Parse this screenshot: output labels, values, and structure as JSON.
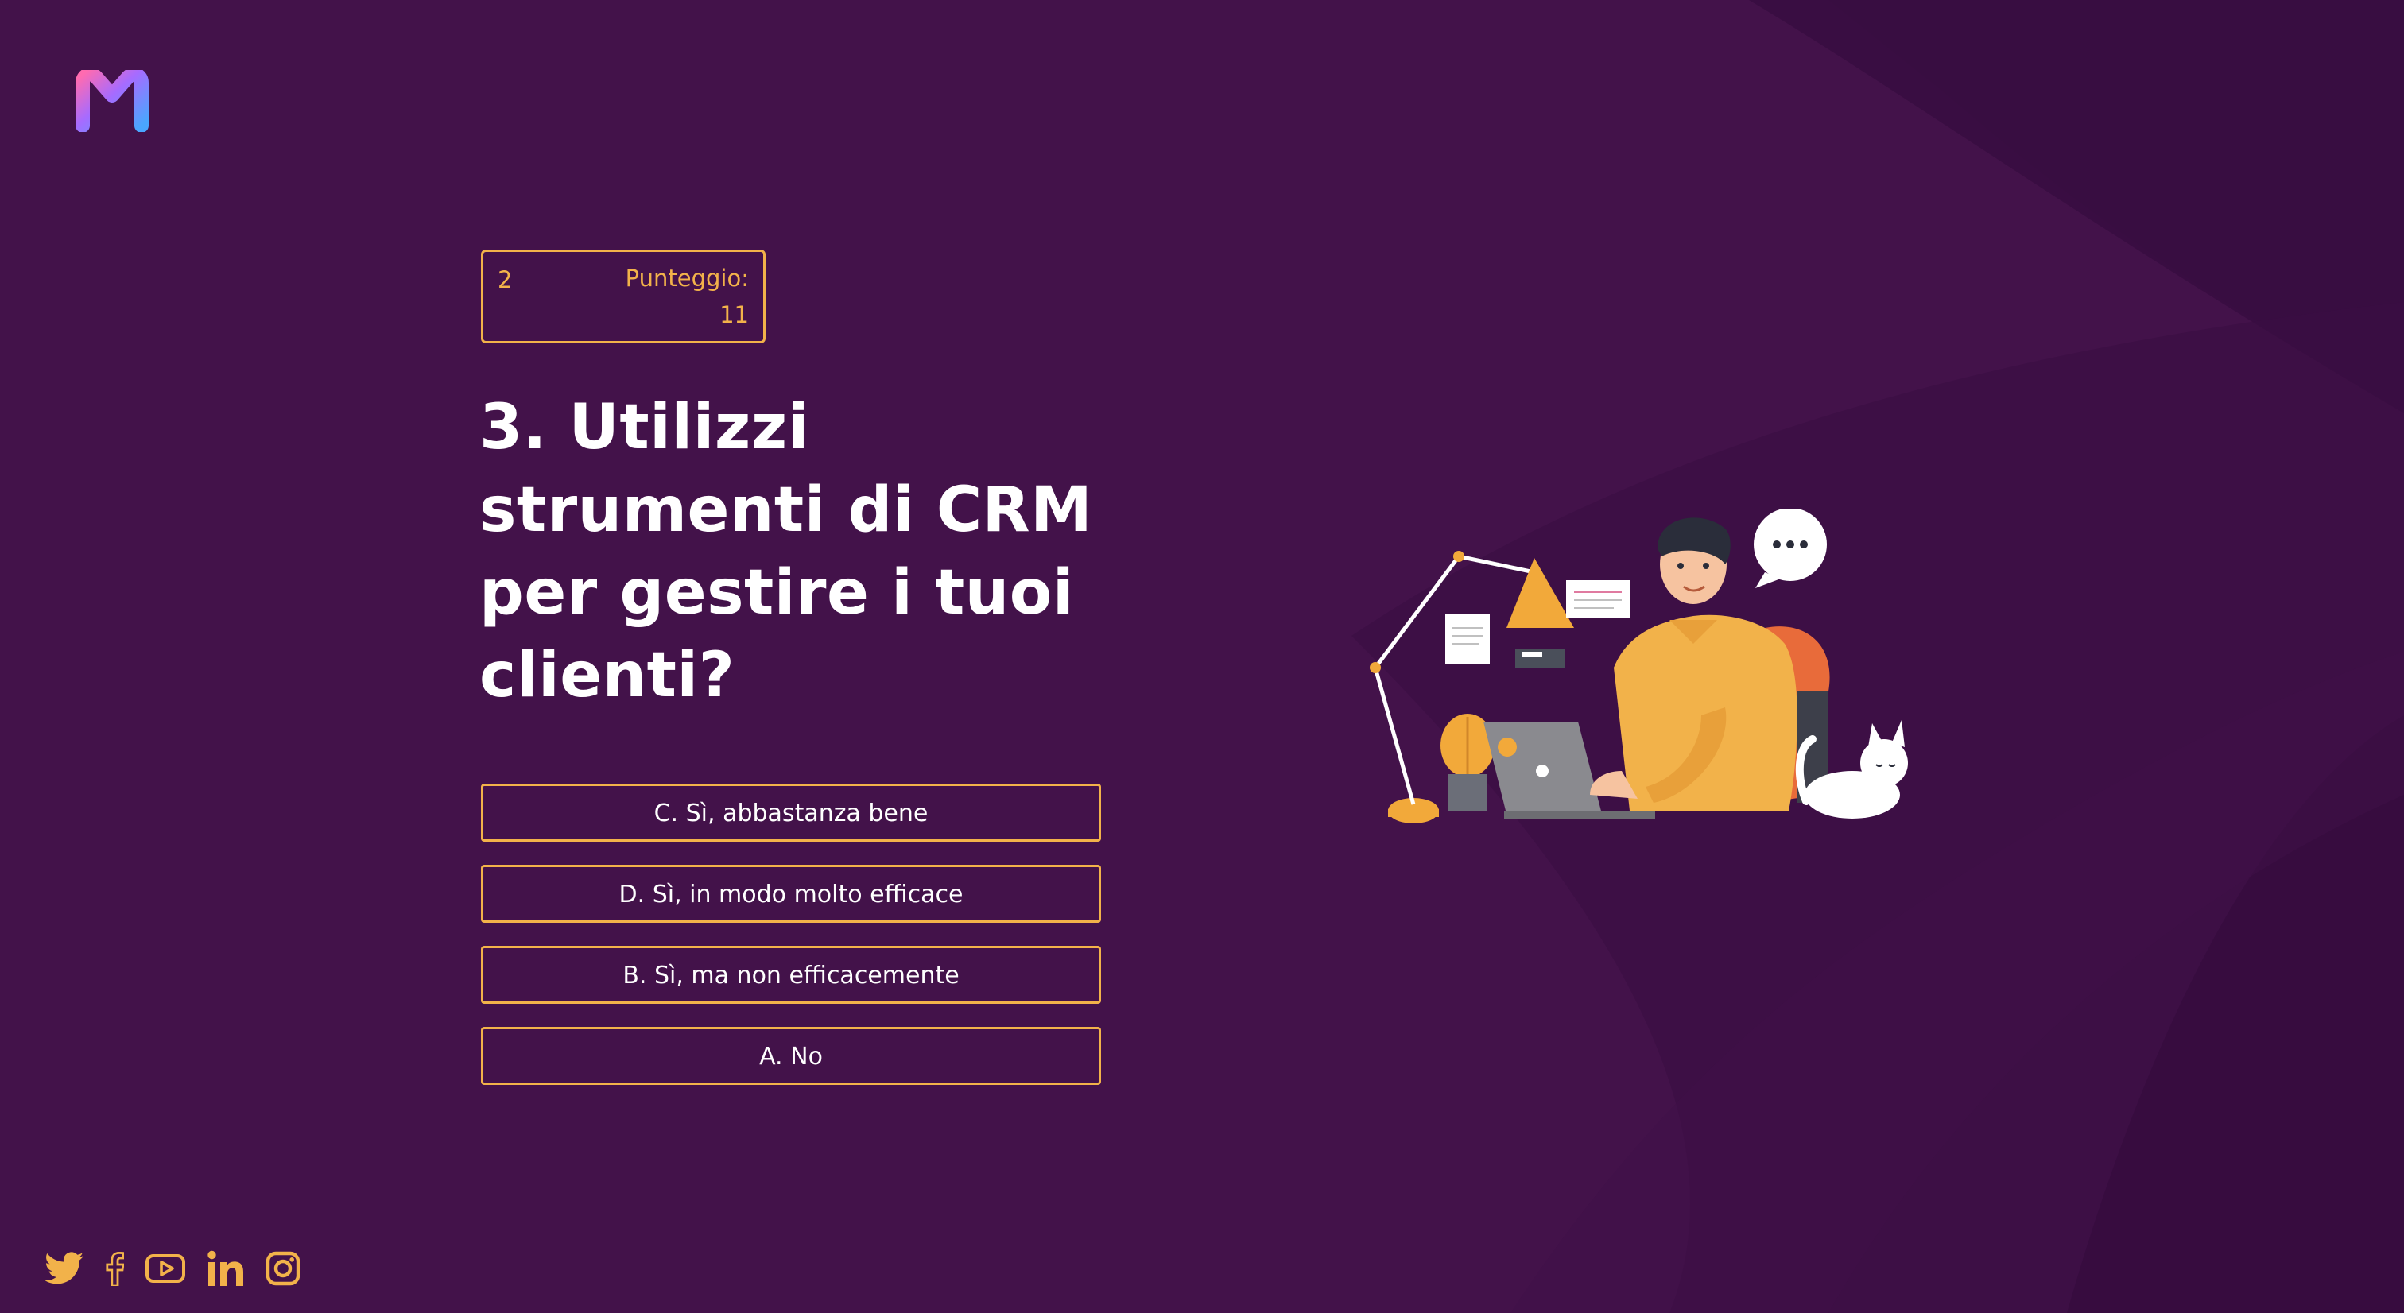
{
  "brand": {
    "logo_icon": "brand-m-logo",
    "gradient_colors": [
      "#ff6bb0",
      "#a66bff",
      "#4aa6ff"
    ]
  },
  "score": {
    "question_number": "2",
    "label_line1": "Punteggio:",
    "label_line2": "11"
  },
  "question": {
    "text": "3. Utilizzi strumenti di CRM per gestire i tuoi clienti?"
  },
  "answers": [
    {
      "label": "C. Sì, abbastanza bene"
    },
    {
      "label": "D. Sì, in modo molto efficace"
    },
    {
      "label": "B. Sì, ma non efficacemente"
    },
    {
      "label": "A. No"
    }
  ],
  "illustration": {
    "icon": "man-at-laptop-with-cat-illustration"
  },
  "socials": [
    {
      "icon": "twitter-icon"
    },
    {
      "icon": "facebook-icon"
    },
    {
      "icon": "youtube-icon"
    },
    {
      "icon": "linkedin-icon"
    },
    {
      "icon": "instagram-icon"
    }
  ],
  "colors": {
    "background": "#43124a",
    "accent": "#f2b24a",
    "text": "#ffffff"
  }
}
